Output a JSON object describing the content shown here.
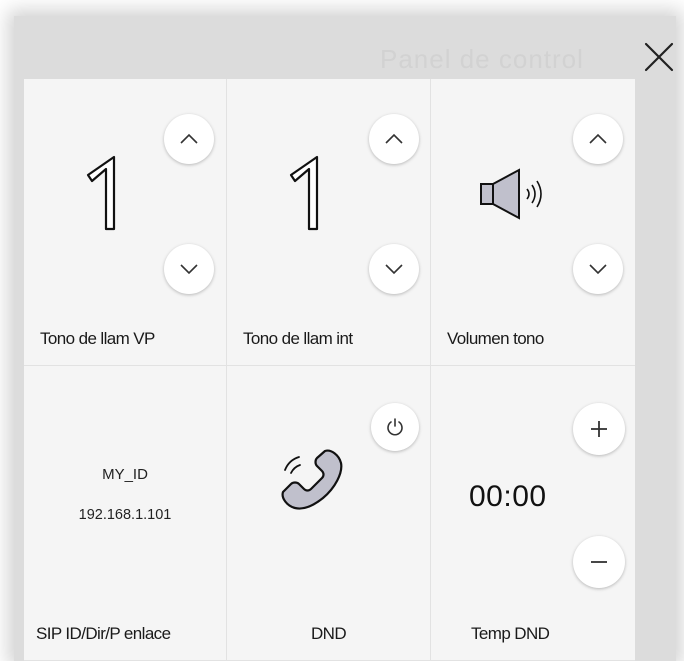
{
  "backdrop": {
    "title": "Panel de control"
  },
  "cells": {
    "vp_ringtone": {
      "value": "1",
      "label": "Tono de llam VP"
    },
    "int_ringtone": {
      "value": "1",
      "label": "Tono de llam int"
    },
    "volume": {
      "label": "Volumen tono",
      "icon": "speaker-icon"
    },
    "sip": {
      "id": "MY_ID",
      "address": "192.168.1.101",
      "label": "SIP ID/Dir/P enlace"
    },
    "dnd": {
      "label": "DND",
      "icon": "phone-icon"
    },
    "dnd_timer": {
      "value": "00:00",
      "label": "Temp DND"
    }
  },
  "colors": {
    "panel": "#f5f5f5",
    "icon_fill": "#c0c0cc",
    "backdrop": "#dcdcdc"
  }
}
